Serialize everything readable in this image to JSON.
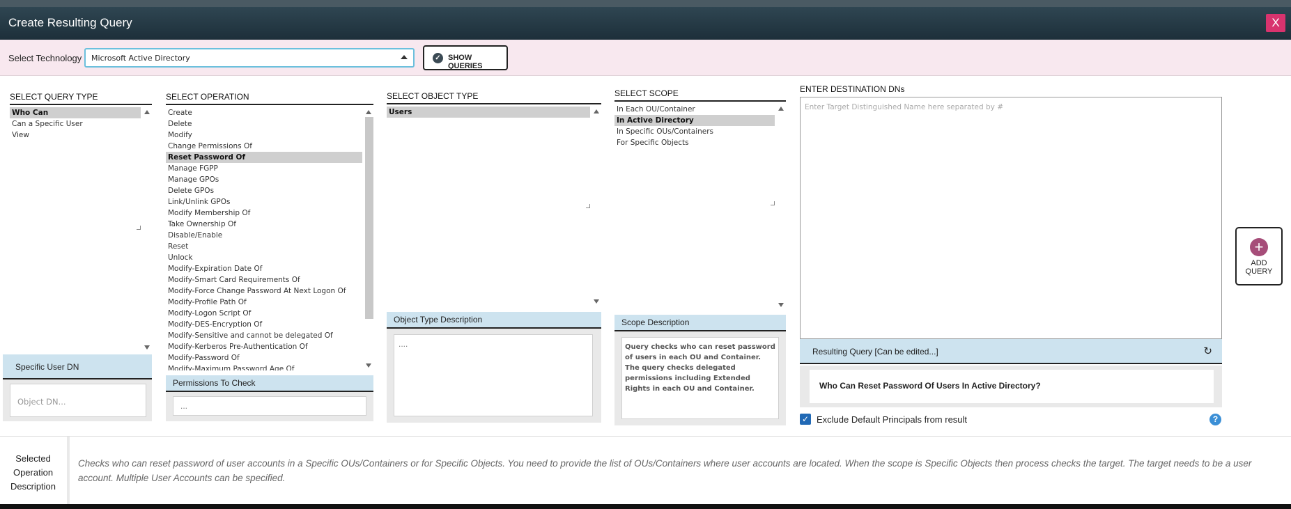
{
  "window": {
    "title": "Create Resulting Query",
    "close_label": "X"
  },
  "tech": {
    "label": "Select Technology",
    "value": "Microsoft Active Directory",
    "show_queries": "SHOW QUERIES"
  },
  "query_type": {
    "heading": "SELECT QUERY TYPE",
    "items": [
      "Who Can",
      "Can a Specific User",
      "View"
    ],
    "selected": 0
  },
  "specific_user": {
    "heading": "Specific User DN",
    "placeholder": "Object DN..."
  },
  "operation": {
    "heading": "SELECT OPERATION",
    "items": [
      "Create",
      "Delete",
      "Modify",
      "Change Permissions Of",
      "Reset Password Of",
      "Manage FGPP",
      "Manage GPOs",
      "Delete GPOs",
      "Link/Unlink GPOs",
      "Modify Membership Of",
      "Take Ownership Of",
      "Disable/Enable",
      "Reset",
      "Unlock",
      "Modify-Expiration Date Of",
      "Modify-Smart Card Requirements Of",
      "Modify-Force Change Password At Next Logon Of",
      "Modify-Profile Path Of",
      "Modify-Logon Script Of",
      "Modify-DES-Encryption Of",
      "Modify-Sensitive and cannot be delegated Of",
      "Modify-Kerberos Pre-Authentication Of",
      "Modify-Password Of",
      "Modify-Maximum Password Age Of"
    ],
    "selected": 4
  },
  "permissions": {
    "heading": "Permissions To Check",
    "value": "..."
  },
  "object_type": {
    "heading": "SELECT OBJECT TYPE",
    "items": [
      "Users"
    ],
    "selected": 0
  },
  "object_desc": {
    "heading": "Object Type Description",
    "value": "...."
  },
  "scope": {
    "heading": "SELECT SCOPE",
    "items": [
      "In Each OU/Container",
      "In Active Directory",
      "In Specific OUs/Containers",
      "For Specific Objects"
    ],
    "selected": 1
  },
  "scope_desc": {
    "heading": "Scope Description",
    "text": "Query checks who can reset password of users in each OU and Container. The query checks delegated permissions including Extended Rights in each OU and Container."
  },
  "destination": {
    "heading": "ENTER DESTINATION DNs",
    "placeholder": "Enter Target Distinguished Name here separated by #"
  },
  "add_query": {
    "line1": "ADD",
    "line2": "QUERY"
  },
  "resulting": {
    "heading": "Resulting Query [Can be edited...]",
    "text": "Who Can Reset Password Of Users In Active Directory?"
  },
  "exclude": {
    "label": "Exclude Default Principals from result",
    "checked": true
  },
  "operation_desc": {
    "label_lines": [
      "Selected",
      "Operation",
      "Description"
    ],
    "text": "Checks who can reset password of user accounts in a Specific OUs/Containers or for Specific Objects. You need to provide the list of OUs/Containers where user accounts are located. When the scope is Specific Objects then process checks the target. The target needs to be a user account. Multiple User Accounts can be specified."
  },
  "colors": {
    "title_bar": "#1d2f3a",
    "close_button": "#d8336e",
    "tech_bar": "#f8e8ef",
    "panel_head": "#cde3ef",
    "add_icon": "#a64d79",
    "checkbox": "#2169b5"
  }
}
